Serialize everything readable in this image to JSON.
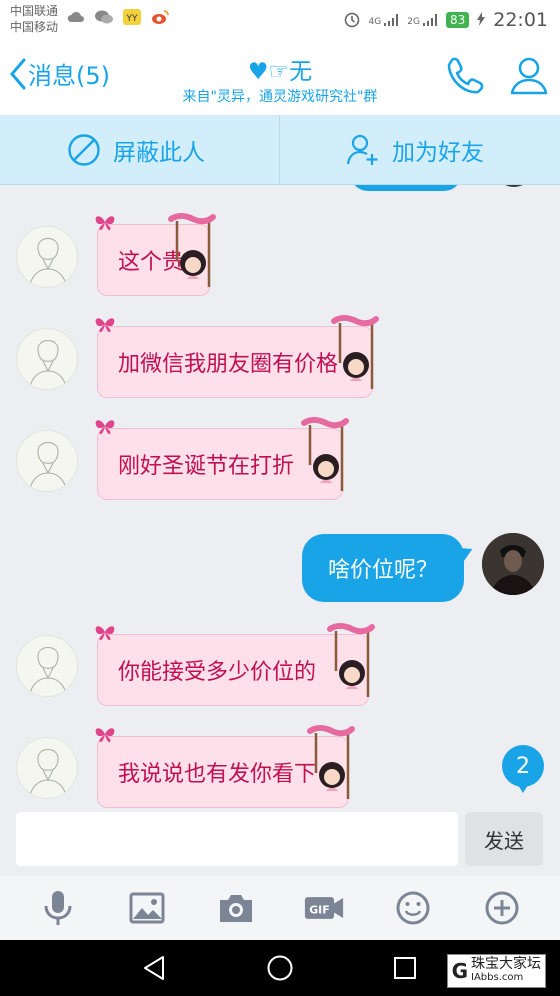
{
  "status_bar": {
    "carrier_1": "中国联通",
    "carrier_2": "中国移动",
    "signal_4g": "4G",
    "signal_2g": "2G",
    "battery": "83",
    "time": "22:01"
  },
  "header": {
    "back_label": "消息(5)",
    "title": "♥☞无",
    "subtitle": "来自\"灵异，通灵游戏研究社\"群"
  },
  "actions": {
    "block_label": "屏蔽此人",
    "add_friend_label": "加为好友"
  },
  "messages": [
    {
      "direction": "in",
      "text": "这个贵"
    },
    {
      "direction": "in",
      "text": "加微信我朋友圈有价格"
    },
    {
      "direction": "in",
      "text": "刚好圣诞节在打折"
    },
    {
      "direction": "out",
      "text": "啥价位呢？"
    },
    {
      "direction": "in",
      "text": "你能接受多少价位的"
    },
    {
      "direction": "in",
      "text": "我说说也有发你看下"
    }
  ],
  "unread_badge": "2",
  "input": {
    "value": "",
    "send_label": "发送"
  },
  "toolbar": {
    "gif_label": "GIF"
  },
  "watermark": {
    "letter": "G",
    "name": "珠宝大家坛",
    "site": "IAbbs.com"
  },
  "colors": {
    "accent": "#1aa4e8",
    "incoming_bubble": "#fde0ea",
    "incoming_text": "#c0104e"
  }
}
